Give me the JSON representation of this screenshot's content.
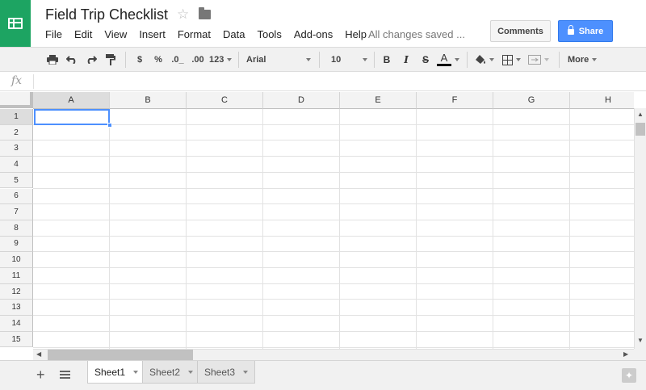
{
  "doc": {
    "title": "Field Trip Checklist",
    "saved_status": "All changes saved ..."
  },
  "menu": [
    "File",
    "Edit",
    "View",
    "Insert",
    "Format",
    "Data",
    "Tools",
    "Add-ons",
    "Help"
  ],
  "header_buttons": {
    "comments": "Comments",
    "share": "Share"
  },
  "toolbar": {
    "currency": "$",
    "percent": "%",
    "dec_decrease": ".0_",
    "dec_increase": ".00",
    "number_format": "123",
    "font": "Arial",
    "font_size": "10",
    "bold": "B",
    "italic": "I",
    "strike": "S",
    "text_color": "A",
    "more": "More"
  },
  "formula_bar": {
    "fx_label": "fx",
    "value": ""
  },
  "grid": {
    "columns": [
      "A",
      "B",
      "C",
      "D",
      "E",
      "F",
      "G",
      "H"
    ],
    "rows": [
      "1",
      "2",
      "3",
      "4",
      "5",
      "6",
      "7",
      "8",
      "9",
      "10",
      "11",
      "12",
      "13",
      "14",
      "15"
    ],
    "active_cell": "A1"
  },
  "sheets": [
    "Sheet1",
    "Sheet2",
    "Sheet3"
  ],
  "colors": {
    "brand": "#1da462",
    "share": "#4d90fe",
    "selection": "#4d90fe"
  }
}
